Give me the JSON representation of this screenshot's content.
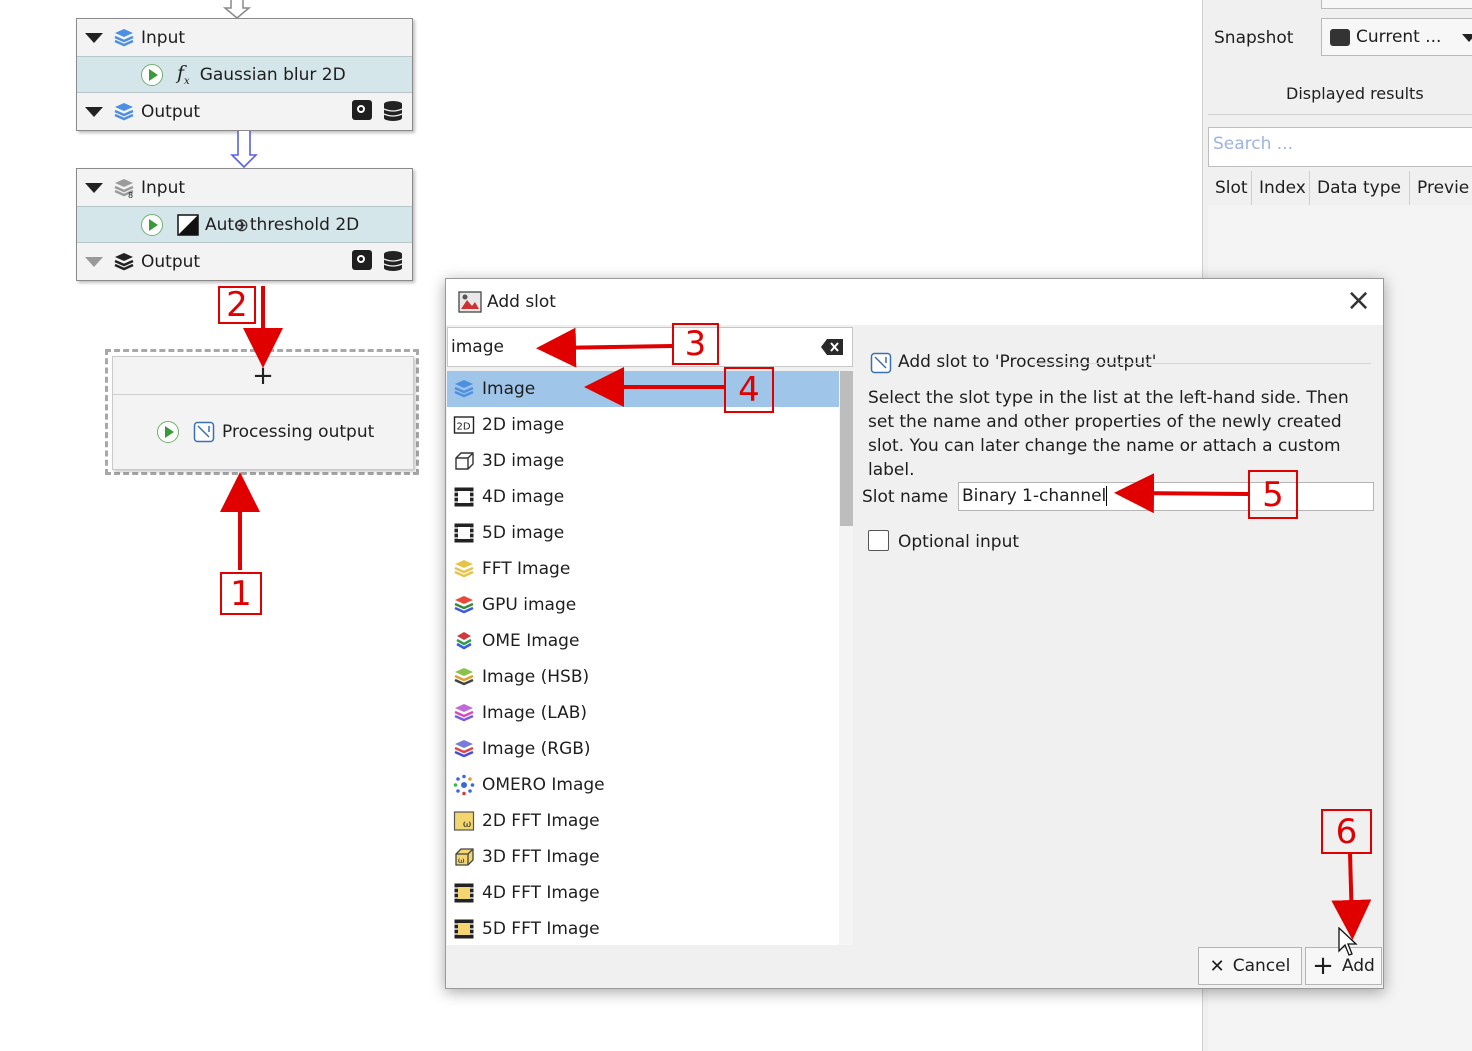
{
  "graph": {
    "node1": {
      "input_label": "Input",
      "algorithm_label": "Gaussian blur 2D",
      "output_label": "Output"
    },
    "node2": {
      "input_label": "Input",
      "algorithm_label": "Auto threshold 2D",
      "output_label": "Output"
    },
    "node3": {
      "add_symbol": "+",
      "algorithm_label": "Processing output"
    }
  },
  "right_panel": {
    "snapshot_label": "Snapshot",
    "snapshot_value": "Current ...",
    "displayed_results_label": "Displayed results",
    "search_placeholder": "Search ...",
    "columns": [
      "Slot",
      "Index",
      "Data type",
      "Previe"
    ]
  },
  "dialog": {
    "title": "Add slot",
    "close_symbol": "×",
    "search_value": "image",
    "header_text": "Add slot to 'Processing output'",
    "description": "Select the slot type in the list at the left-hand side. Then set the name and other properties of the newly created slot. You can later change the name or attach a custom label.",
    "slot_name_label": "Slot name",
    "slot_name_value": "Binary 1-channel",
    "optional_input_label": "Optional input",
    "cancel_label": "Cancel",
    "add_label": "Add",
    "items": [
      {
        "label": "Image",
        "icon": "image-stack-icon",
        "selected": true
      },
      {
        "label": "2D image",
        "icon": "image-2d-icon"
      },
      {
        "label": "3D image",
        "icon": "image-3d-icon"
      },
      {
        "label": "4D image",
        "icon": "image-4d-icon"
      },
      {
        "label": "5D image",
        "icon": "image-5d-icon"
      },
      {
        "label": "FFT Image",
        "icon": "fft-image-icon"
      },
      {
        "label": "GPU image",
        "icon": "gpu-image-icon"
      },
      {
        "label": "OME Image",
        "icon": "ome-image-icon"
      },
      {
        "label": "Image (HSB)",
        "icon": "image-hsb-icon"
      },
      {
        "label": "Image (LAB)",
        "icon": "image-lab-icon"
      },
      {
        "label": "Image (RGB)",
        "icon": "image-rgb-icon"
      },
      {
        "label": "OMERO Image",
        "icon": "omero-image-icon"
      },
      {
        "label": "2D FFT Image",
        "icon": "fft-2d-icon"
      },
      {
        "label": "3D FFT Image",
        "icon": "fft-3d-icon"
      },
      {
        "label": "4D FFT Image",
        "icon": "fft-4d-icon"
      },
      {
        "label": "5D FFT Image",
        "icon": "fft-5d-icon"
      }
    ]
  },
  "annotations": {
    "n1": "1",
    "n2": "2",
    "n3": "3",
    "n4": "4",
    "n5": "5",
    "n6": "6"
  },
  "colors": {
    "accent_red": "#e00000",
    "selection": "#9fc5e8",
    "node_title_bg": "#d5e6ea",
    "slot_blue": "#3f7fd8"
  }
}
